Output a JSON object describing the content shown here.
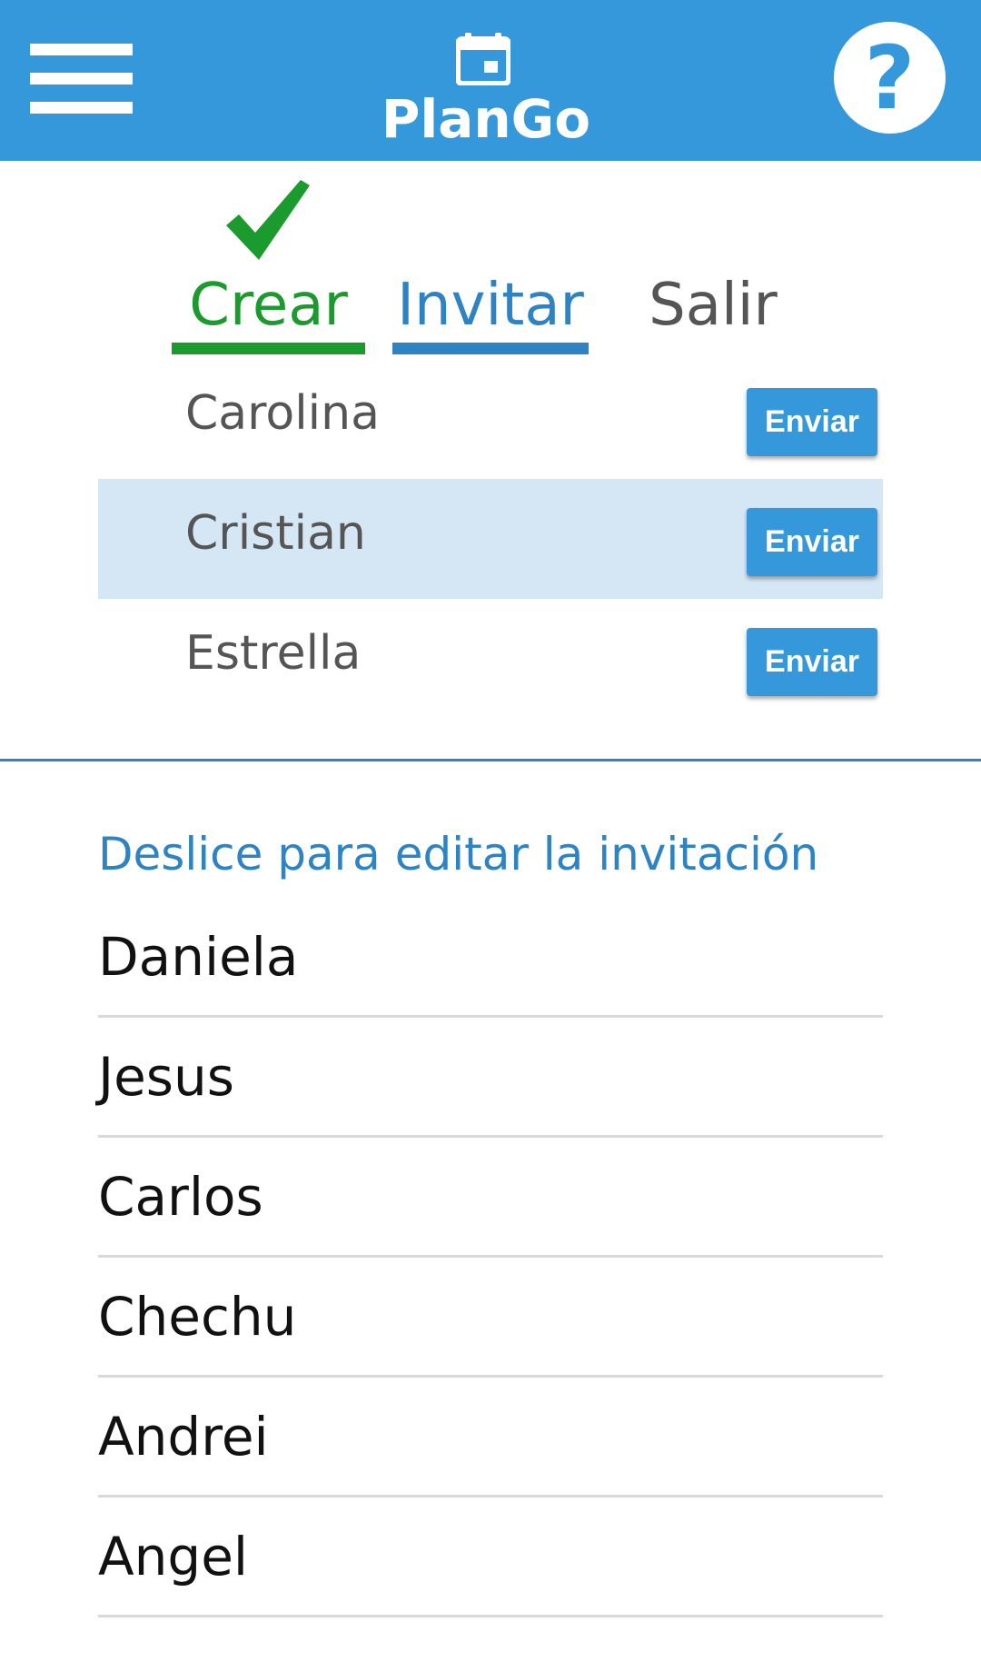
{
  "header": {
    "title": "PlanGo",
    "menu_icon": "hamburger-menu-icon",
    "calendar_icon": "calendar-icon",
    "help_label": "?",
    "background_color": "#3598DB"
  },
  "tabs": [
    {
      "label": "Crear",
      "color": "#1B9A2D",
      "completed": true
    },
    {
      "label": "Invitar",
      "color": "#2E83C2",
      "active": true
    },
    {
      "label": "Salir",
      "color": "#555555"
    }
  ],
  "invite_rows": [
    {
      "name": "Carolina",
      "button": "Enviar"
    },
    {
      "name": "Cristian",
      "button": "Enviar",
      "highlighted": true
    },
    {
      "name": "Estrella",
      "button": "Enviar"
    }
  ],
  "hint_text": "Deslice para editar la invitación",
  "contacts": [
    "Daniela",
    "Jesus",
    "Carlos",
    "Chechu",
    "Andrei",
    "Angel"
  ]
}
